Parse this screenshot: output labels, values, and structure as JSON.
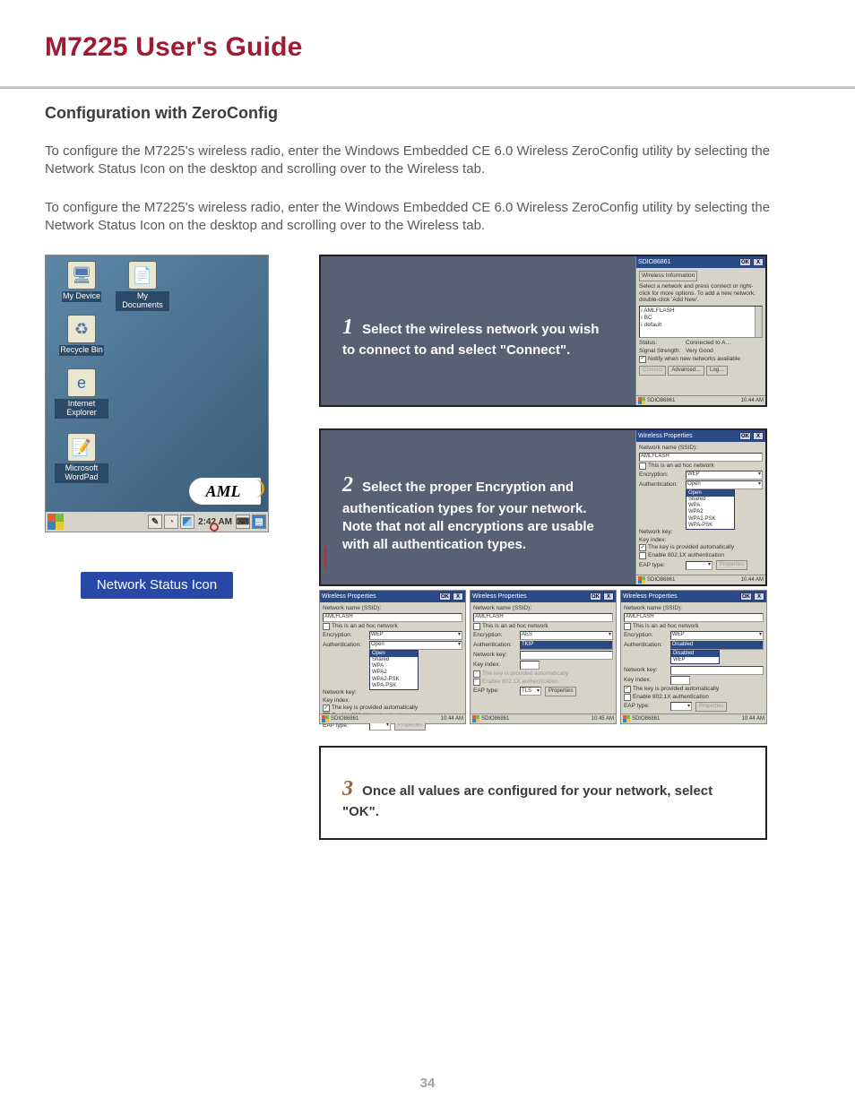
{
  "doc": {
    "title": "M7225 User's Guide",
    "page_number": "34"
  },
  "section": {
    "heading": "Configuration with ZeroConfig",
    "para1": "To configure the M7225's wireless radio, enter the Windows Embedded CE 6.0 Wireless ZeroConfig utility by selecting the Network Status Icon on the desktop and scrolling over to the Wireless tab.",
    "para2": "To configure the M7225's wireless radio, enter the Windows Embedded CE 6.0 Wireless ZeroConfig utility by selecting the Network Status Icon on the desktop and scrolling over to the Wireless tab."
  },
  "desktop": {
    "icons": {
      "my_device": "My Device",
      "my_documents": "My\nDocuments",
      "recycle_bin": "Recycle Bin",
      "internet_explorer": "Internet\nExplorer",
      "wordpad": "Microsoft\nWordPad"
    },
    "clock": "2:42 AM",
    "brand": "AML"
  },
  "callout": {
    "text": "Network Status Icon"
  },
  "steps": {
    "s1_num": "1",
    "s1_text": "Select the wireless network you wish to connect to and select \"Connect\".",
    "s2_num": "2",
    "s2_text": "Select the proper Encryption and authentication types for your network.  Note that not all encryptions are usable with all authentication types.",
    "s3_num": "3",
    "s3_text": "Once all values are configured for your network, select \"OK\"."
  },
  "dlg": {
    "title_info": "SDIO86861",
    "tab_wi": "Wireless Information",
    "help": "Select a network and press connect or right-click for more options.  To add a new network, double-click 'Add New'.",
    "net_amlflash": "AMLFLASH",
    "net_bc": "BC",
    "net_default": "default",
    "status_lbl": "Status:",
    "status_val": "Connected to A…",
    "signal_lbl": "Signal Strength:",
    "signal_val": "Very Good",
    "notify": "Notify when new networks available",
    "btn_connect": "Connect",
    "btn_advanced": "Advanced…",
    "btn_log": "Log…",
    "ok": "OK",
    "x": "X",
    "wp_title": "Wireless Properties",
    "nn_lbl": "Network name (SSID):",
    "adhoc": "This is an ad hoc network",
    "enc_lbl": "Encryption:",
    "enc_wep": "WEP",
    "enc_aes": "AES",
    "auth_lbl": "Authentication:",
    "auth_open": "Open",
    "auth_tkip": "TKIP",
    "auth_disabled": "Disabled",
    "nkey_lbl": "Network key:",
    "kidx_lbl": "Key index:",
    "keyauto": "The key is provided automatically",
    "en8021x": "Enable 802.1X authentication",
    "eap_lbl": "EAP type:",
    "eap_tls": "TLS",
    "btn_props": "Properties",
    "taskclock": "10:44 AM",
    "taskclock2": "10:45 AM",
    "drop_open": "Open",
    "drop_shared": "Shared",
    "drop_wpa": "WPA",
    "drop_wpa2": "WPA2",
    "drop_wpa2psk": "WPA2-PSK",
    "drop_wpapsk": "WPA-PSK",
    "drop_wep": "WEP",
    "drop_disabled": "Disabled"
  }
}
